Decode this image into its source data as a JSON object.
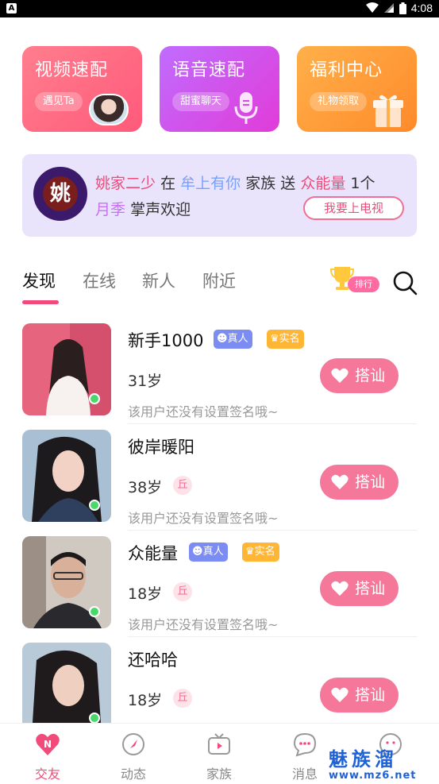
{
  "status_bar": {
    "time": "4:08",
    "app_icon": "A"
  },
  "feature_cards": [
    {
      "title": "视频速配",
      "subtitle": "遇见Ta"
    },
    {
      "title": "语音速配",
      "subtitle": "甜蜜聊天"
    },
    {
      "title": "福利中心",
      "subtitle": "礼物领取"
    }
  ],
  "banner": {
    "badge_text": "姚",
    "user": "姚家二少",
    "word_at": "在",
    "family": "牟上有你",
    "word_family": "家族",
    "word_send": "送",
    "gift": "众能量",
    "gift_count": "1个",
    "receiver": "月季",
    "applause": "掌声欢迎",
    "cta": "我要上电视"
  },
  "tabs": [
    "发现",
    "在线",
    "新人",
    "附近"
  ],
  "rank_label": "排行",
  "users": [
    {
      "name": "新手1000",
      "tags": [
        "真人",
        "实名"
      ],
      "age": "31岁",
      "qiu": "",
      "bio": "该用户还没有设置签名哦~",
      "button": "搭讪",
      "online": true
    },
    {
      "name": "彼岸暖阳",
      "tags": [],
      "age": "38岁",
      "qiu": "丘",
      "bio": "该用户还没有设置签名哦~",
      "button": "搭讪",
      "online": true
    },
    {
      "name": "众能量",
      "tags": [
        "真人",
        "实名"
      ],
      "age": "18岁",
      "qiu": "丘",
      "bio": "该用户还没有设置签名哦~",
      "button": "搭讪",
      "online": true
    },
    {
      "name": "还哈哈",
      "tags": [],
      "age": "18岁",
      "qiu": "丘",
      "bio": "",
      "button": "搭讪",
      "online": true
    }
  ],
  "bottom_nav": [
    {
      "label": "交友",
      "icon": "heart-n-icon",
      "active": true
    },
    {
      "label": "动态",
      "icon": "compass-icon",
      "active": false
    },
    {
      "label": "家族",
      "icon": "tv-icon",
      "active": false
    },
    {
      "label": "消息",
      "icon": "chat-bubble-icon",
      "active": false
    },
    {
      "label": "",
      "icon": "profile-icon",
      "active": false
    }
  ],
  "watermark": {
    "text": "魅族溜",
    "url": "www.mz6.net"
  },
  "colors": {
    "accent": "#f04b7a",
    "button": "#f5779a",
    "online": "#4bd86b"
  }
}
